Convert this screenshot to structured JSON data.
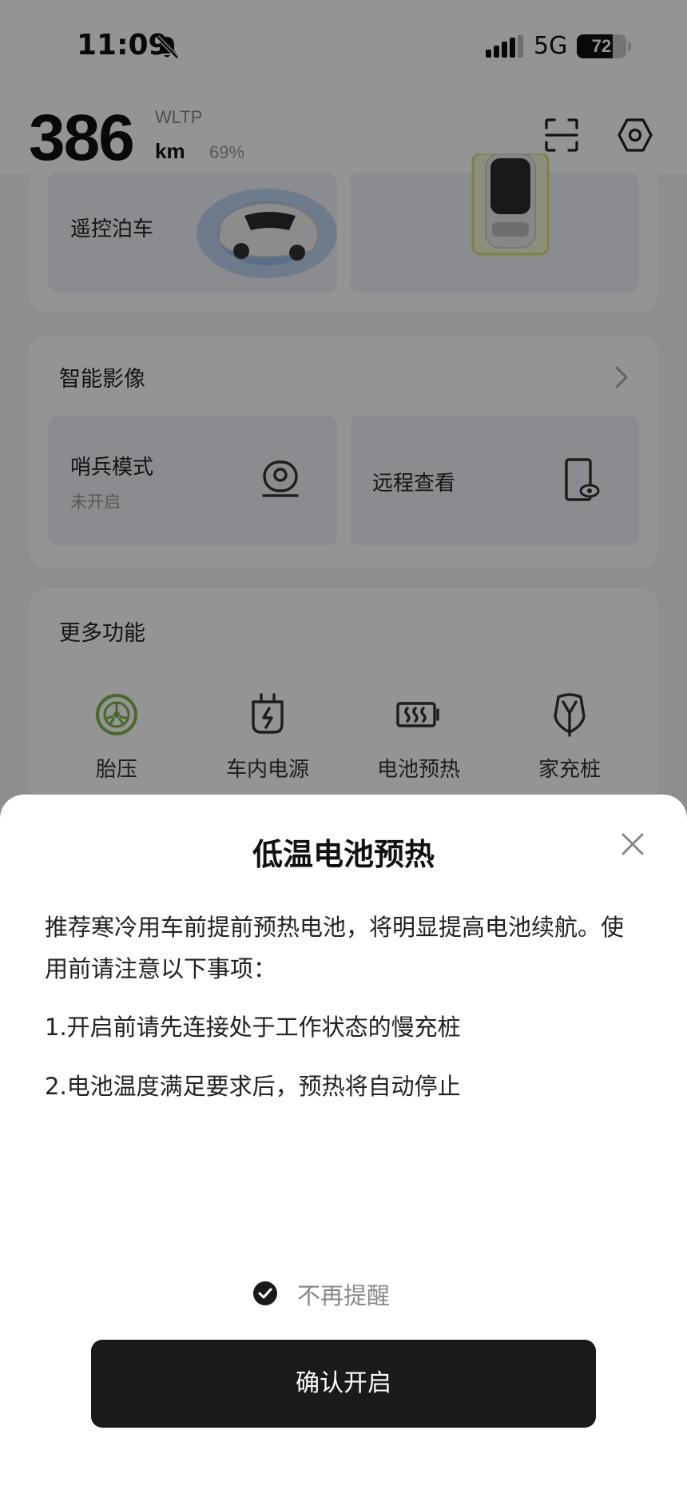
{
  "status_bar": {
    "time": "11:09",
    "network": "5G",
    "battery_percent": 72,
    "battery_text": "72",
    "mute_icon": "bell-slash-icon",
    "signal_icon": "cellular-signal-icon"
  },
  "range": {
    "value": "386",
    "standard": "WLTP",
    "unit": "km",
    "percent": "69%"
  },
  "header_icons": {
    "scan_icon": "scan-icon",
    "settings_icon": "hexagon-settings-icon"
  },
  "parking_card": {
    "remote_parking_label": "遥控泊车"
  },
  "smart_video_card": {
    "title": "智能影像",
    "sentry_title": "哨兵模式",
    "sentry_status": "未开启",
    "remote_view_title": "远程查看"
  },
  "more_features_card": {
    "title": "更多功能",
    "items": [
      {
        "label": "胎压",
        "icon": "tire-pressure-icon"
      },
      {
        "label": "车内电源",
        "icon": "power-plug-icon"
      },
      {
        "label": "电池预热",
        "icon": "battery-heat-icon"
      },
      {
        "label": "家充桩",
        "icon": "home-charger-icon"
      }
    ]
  },
  "sheet": {
    "title": "低温电池预热",
    "intro": "推荐寒冷用车前提前预热电池，将明显提高电池续航。使用前请注意以下事项：",
    "note_1": "1.开启前请先连接处于工作状态的慢充桩",
    "note_2": "2.电池温度满足要求后，预热将自动停止",
    "dont_remind_label": "不再提醒",
    "dont_remind_checked": true,
    "confirm_label": "确认开启"
  },
  "colors": {
    "accent_green": "#7ab648",
    "button_dark": "#1a1a1a",
    "tile_bg": "#eef2f6",
    "overlay": "rgba(0,0,0,0.42)"
  }
}
